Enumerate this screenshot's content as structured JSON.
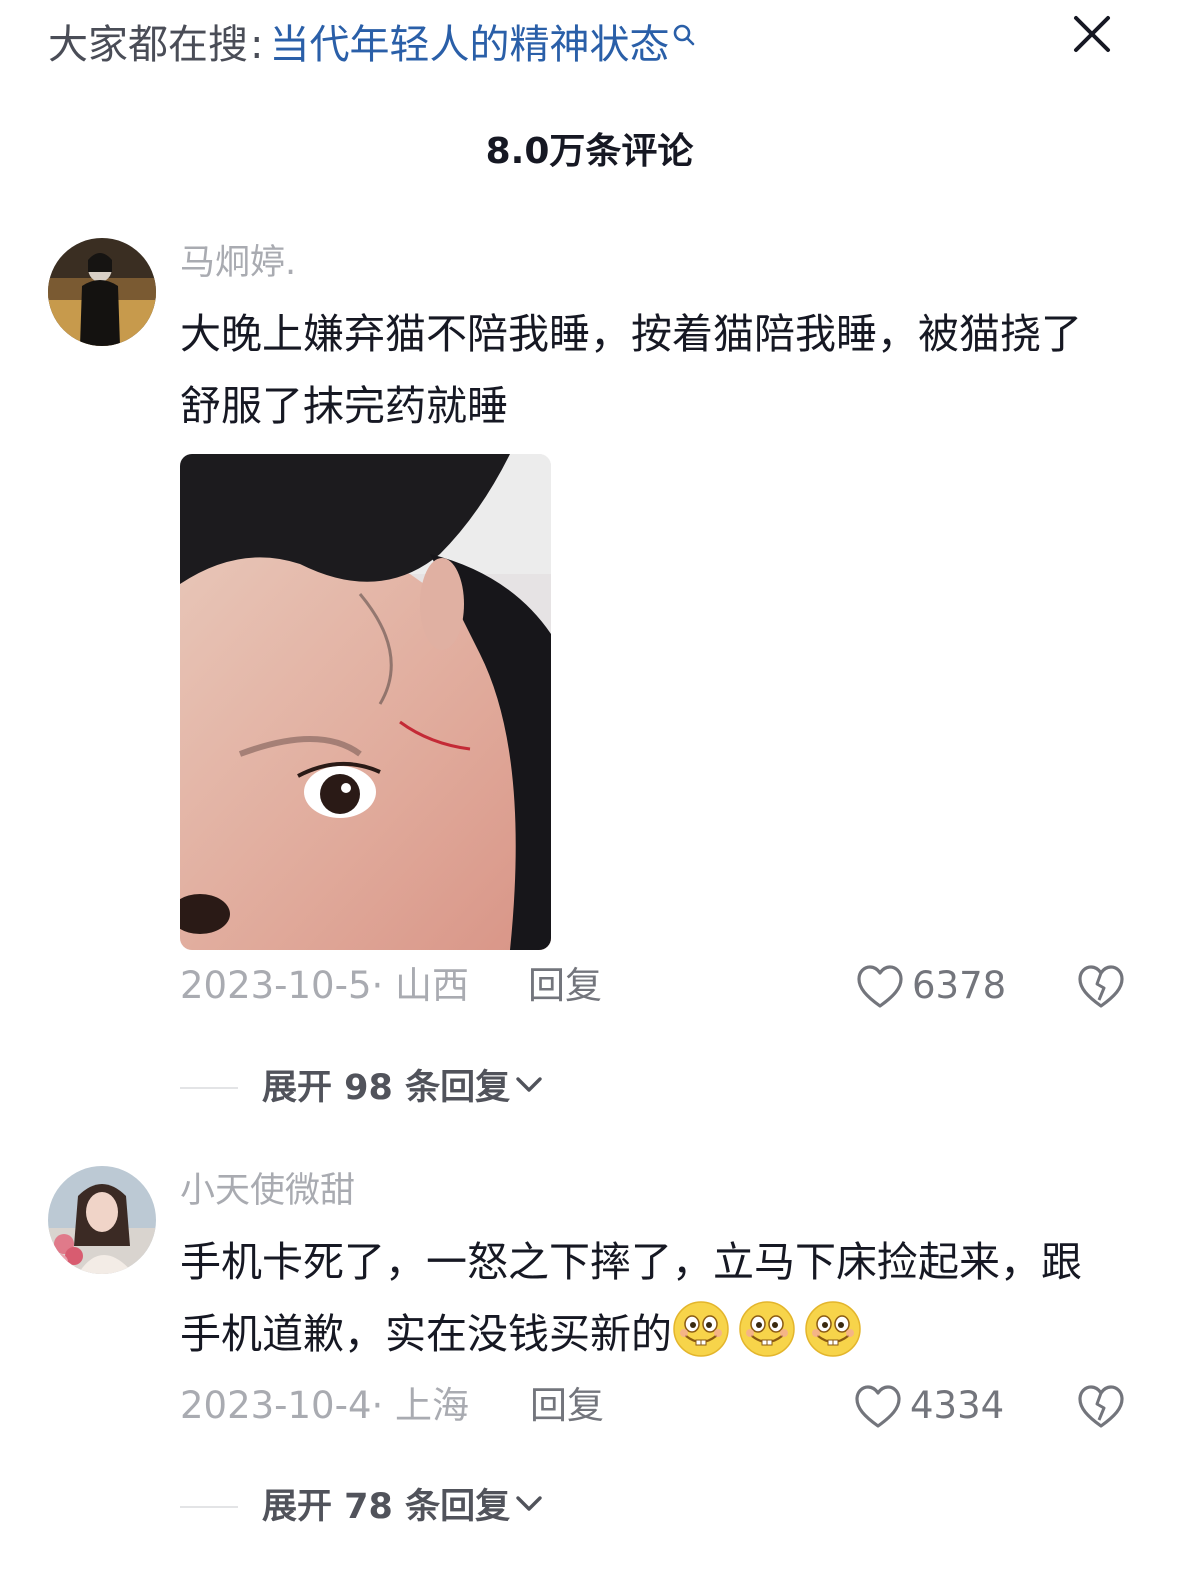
{
  "header": {
    "hint_prefix": "大家都在搜",
    "hint_separator": ":",
    "hint_keyword": "当代年轻人的精神状态",
    "close_icon": "close-icon",
    "search_icon": "search-icon"
  },
  "comments_header": {
    "count_label": "8.0万条评论"
  },
  "comments": [
    {
      "username": "马炯婷.",
      "text": "大晚上嫌弃猫不陪我睡，按着猫陪我睡，被猫挠了舒服了抹完药就睡",
      "has_image": true,
      "date_location": "2023-10-5· 山西",
      "reply_label": "回复",
      "likes": "6378",
      "expand_label": "展开 98 条回复"
    },
    {
      "username": "小天使微甜",
      "text": "手机卡死了，一怒之下摔了，立马下床捡起来，跟手机道歉，实在没钱买新的",
      "emojis": [
        "smirk-emoji",
        "smirk-emoji",
        "smirk-emoji"
      ],
      "date_location": "2023-10-4· 上海",
      "reply_label": "回复",
      "likes": "4334",
      "expand_label": "展开 78 条回复"
    }
  ],
  "colors": {
    "keyword_link": "#2a5fa8",
    "muted_text": "#a9abb1",
    "primary_text": "#161823"
  }
}
